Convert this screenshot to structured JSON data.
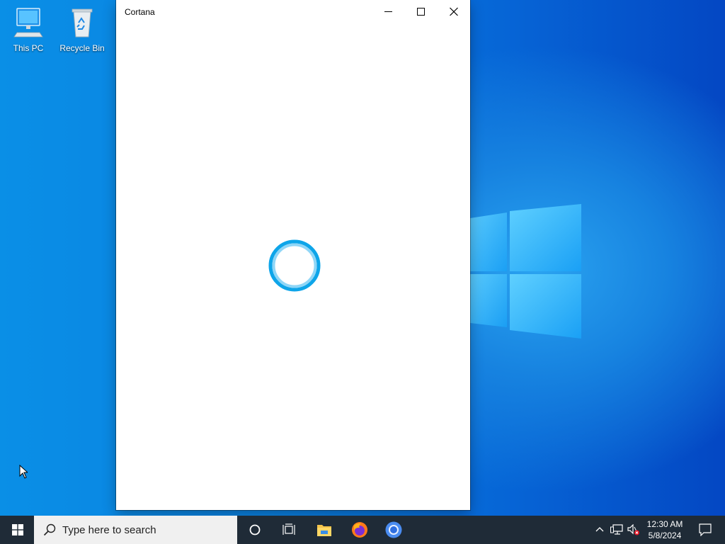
{
  "desktop": {
    "icons": [
      {
        "label": "This PC",
        "icon": "computer-icon"
      },
      {
        "label": "Recycle Bin",
        "icon": "recycle-bin-icon"
      }
    ]
  },
  "window": {
    "title": "Cortana",
    "buttons": [
      "minimize",
      "maximize",
      "close"
    ],
    "loading_state": "cortana-loading-ring"
  },
  "taskbar": {
    "search_placeholder": "Type here to search",
    "pinned": [
      "cortana-icon",
      "task-view-icon",
      "file-explorer-icon",
      "firefox-icon",
      "chrome-icon"
    ],
    "tray": [
      "show-hidden-icons-icon",
      "network-icon",
      "volume-muted-icon"
    ],
    "time": "12:30 AM",
    "date": "5/8/2024",
    "notification_icon": "action-center-icon"
  },
  "colors": {
    "accent": "#0ea5e9",
    "taskbar": "#1f2b37",
    "desktop": "#0a7fe0"
  }
}
